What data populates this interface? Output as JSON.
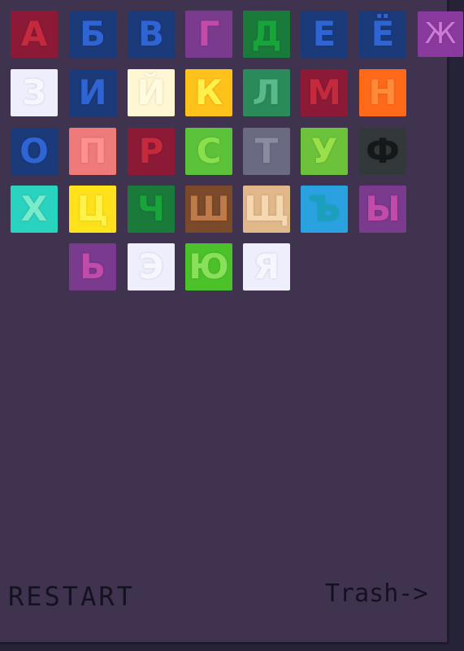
{
  "tiles": [
    {
      "letter": "А",
      "bg": "#8c1a36",
      "fg": "#c52a3c"
    },
    {
      "letter": "Б",
      "bg": "#1b3a7a",
      "fg": "#2f64d4"
    },
    {
      "letter": "В",
      "bg": "#1b3a7a",
      "fg": "#2f64d4"
    },
    {
      "letter": "Г",
      "bg": "#7a3a8e",
      "fg": "#c24aa8"
    },
    {
      "letter": "Д",
      "bg": "#1a7a3a",
      "fg": "#17a43a"
    },
    {
      "letter": "Е",
      "bg": "#1b3a7a",
      "fg": "#2f64d4"
    },
    {
      "letter": "Ё",
      "bg": "#1b3a7a",
      "fg": "#2f64d4"
    },
    {
      "letter": "З",
      "bg": "#eeeefc",
      "fg": "#f6f6ff"
    },
    {
      "letter": "И",
      "bg": "#1b3a7a",
      "fg": "#2f64d4"
    },
    {
      "letter": "Й",
      "bg": "#fff6d4",
      "fg": "#fffae0"
    },
    {
      "letter": "К",
      "bg": "#ffc21a",
      "fg": "#fff04a"
    },
    {
      "letter": "Л",
      "bg": "#2a8a5a",
      "fg": "#5ab88a"
    },
    {
      "letter": "М",
      "bg": "#8c1a36",
      "fg": "#c52a3c"
    },
    {
      "letter": "Н",
      "bg": "#ff6a1a",
      "fg": "#ff8a3a"
    },
    {
      "letter": "О",
      "bg": "#1b3a7a",
      "fg": "#2f64d4"
    },
    {
      "letter": "П",
      "bg": "#ef7a7a",
      "fg": "#ff9090"
    },
    {
      "letter": "Р",
      "bg": "#8c1a36",
      "fg": "#c52a3c"
    },
    {
      "letter": "С",
      "bg": "#5cc23a",
      "fg": "#8ae04a"
    },
    {
      "letter": "Т",
      "bg": "#6a6a82",
      "fg": "#8a8aa0"
    },
    {
      "letter": "У",
      "bg": "#6cc23a",
      "fg": "#9ae04a"
    },
    {
      "letter": "Ф",
      "bg": "#33393a",
      "fg": "#141818"
    },
    {
      "letter": "Х",
      "bg": "#2ad2c0",
      "fg": "#7aeac8"
    },
    {
      "letter": "Ц",
      "bg": "#ffe21a",
      "fg": "#fff24a"
    },
    {
      "letter": "Ч",
      "bg": "#1a7a3a",
      "fg": "#17a43a"
    },
    {
      "letter": "Ш",
      "bg": "#7a4a2a",
      "fg": "#c07a4a"
    },
    {
      "letter": "Щ",
      "bg": "#e0b88a",
      "fg": "#f6d8b0"
    },
    {
      "letter": "Ъ",
      "bg": "#2aa2e0",
      "fg": "#1aa0b8"
    },
    {
      "letter": "Ы",
      "bg": "#7a3a8e",
      "fg": "#c24aa8"
    },
    {
      "letter": "Ь",
      "bg": "#7a3a8e",
      "fg": "#c24aa8"
    },
    {
      "letter": "Э",
      "bg": "#eeeefc",
      "fg": "#f6f6ff"
    },
    {
      "letter": "Ю",
      "bg": "#4cc22a",
      "fg": "#8ae05a"
    },
    {
      "letter": "Я",
      "bg": "#eeeefc",
      "fg": "#f6f6ff"
    }
  ],
  "loose_tile": {
    "letter": "Ж",
    "bg": "#8a3a9e",
    "fg": "#d07ad8"
  },
  "restart_label": "RESTART",
  "trash_label": "Trash->"
}
